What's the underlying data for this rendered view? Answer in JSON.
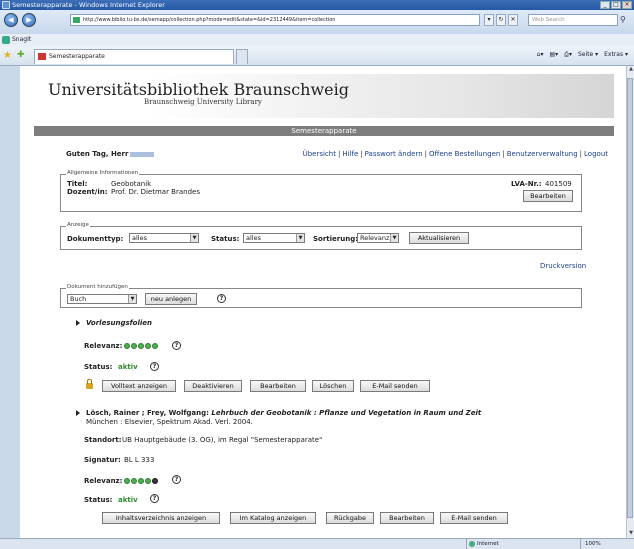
{
  "window": {
    "title": "Semesterapparate - Windows Internet Explorer",
    "address": "http://www.biblio.tu-bs.de/semapp/collection.php?mode=edit&state=&id=2312449&item=collection",
    "search_placeholder": "Web Search",
    "links_label": "SnagIt",
    "tab_title": "Semesterapparate",
    "cmd_page": "Seite",
    "cmd_extras": "Extras",
    "status_zone": "Internet",
    "status_zoom": "100%"
  },
  "header": {
    "title": "Universitätsbibliothek Braunschweig",
    "subtitle": "Braunschweig University Library",
    "section": "Semesterapparate"
  },
  "greeting": "Guten Tag, Herr",
  "nav": [
    "Übersicht",
    "Hilfe",
    "Passwort ändern",
    "Offene Bestellungen",
    "Benutzerverwaltung",
    "Logout"
  ],
  "general": {
    "legend": "Allgemeine Informationen",
    "title_label": "Titel:",
    "title_value": "Geobotanik",
    "lecturer_label": "Dozent/in:",
    "lecturer_value": "Prof. Dr. Dietmar Brandes",
    "lva_label": "LVA-Nr.:",
    "lva_value": "401509",
    "edit_button": "Bearbeiten"
  },
  "display": {
    "legend": "Anzeige",
    "doctype_label": "Dokumenttyp:",
    "doctype_value": "alles",
    "status_label": "Status:",
    "status_value": "alles",
    "sort_label": "Sortierung:",
    "sort_value": "Relevanz",
    "refresh_button": "Aktualisieren"
  },
  "print_link": "Druckversion",
  "add_doc": {
    "legend": "Dokument hinzufügen",
    "type_value": "Buch",
    "new_button": "neu anlegen"
  },
  "items": [
    {
      "title": "Vorlesungsfolien",
      "relevance_label": "Relevanz:",
      "relevance": 5,
      "status_label": "Status:",
      "status_value": "aktiv",
      "buttons": [
        "Volltext anzeigen",
        "Deaktivieren",
        "Bearbeiten",
        "Löschen",
        "E-Mail senden"
      ]
    },
    {
      "title_prefix": "Lösch, Rainer ; Frey, Wolfgang: ",
      "title_italic": "Lehrbuch der Geobotanik : Pflanze und Vegetation in Raum und Zeit",
      "publisher": "München : Elsevier, Spektrum Akad. Verl. 2004.",
      "location_label": "Standort:",
      "location_value": "UB Hauptgebäude (3. OG), im Regal \"Semesterapparate\"",
      "signature_label": "Signatur:",
      "signature_value": "BL L 333",
      "relevance_label": "Relevanz:",
      "relevance": 4,
      "status_label": "Status:",
      "status_value": "aktiv",
      "buttons": [
        "Inhaltsverzeichnis anzeigen",
        "Im Katalog anzeigen",
        "Rückgabe",
        "Bearbeiten",
        "E-Mail senden"
      ]
    }
  ]
}
